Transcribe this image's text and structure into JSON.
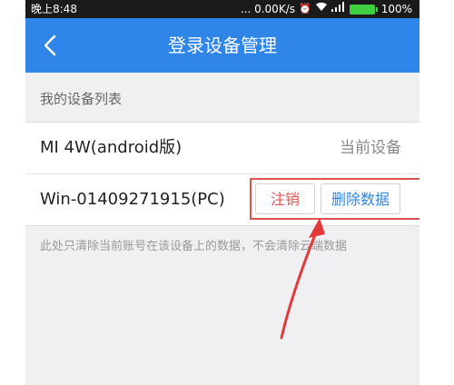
{
  "status_bar": {
    "time": "晚上8:48",
    "network_speed": "... 0.00K/s",
    "battery": "100%"
  },
  "header": {
    "title": "登录设备管理",
    "back_icon": "chevron-left-icon"
  },
  "section": {
    "title": "我的设备列表"
  },
  "devices": [
    {
      "name": "MI 4W(android版)",
      "status": "当前设备"
    },
    {
      "name": "Win-01409271915(PC)",
      "logout_label": "注销",
      "delete_label": "删除数据"
    }
  ],
  "note": "此处只清除当前账号在该设备上的数据，不会清除云端数据",
  "colors": {
    "primary_blue": "#2f86e8",
    "danger_red": "#e05555",
    "annotation_red": "#d9534f"
  }
}
